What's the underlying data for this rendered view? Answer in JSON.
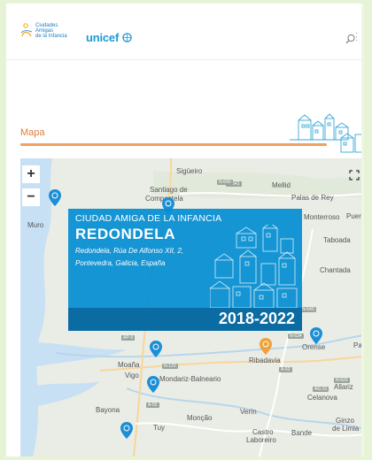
{
  "header": {
    "logo_lines": [
      "Ciudades",
      "Amigas",
      "de la Infancia"
    ],
    "partner_logo": "unicef",
    "icons": {
      "search": "search-icon",
      "menu": "more-vertical-icon"
    }
  },
  "section": {
    "title": "Mapa"
  },
  "map": {
    "zoom_in": "+",
    "zoom_out": "−",
    "places": [
      {
        "name": "Sigüeiro"
      },
      {
        "name": "Santiago de"
      },
      {
        "name": "Compostela"
      },
      {
        "name": "Mellid"
      },
      {
        "name": "Palas de Rey"
      },
      {
        "name": "Muro"
      },
      {
        "name": "Monterroso"
      },
      {
        "name": "Puert"
      },
      {
        "name": "Taboada"
      },
      {
        "name": "Chantada"
      },
      {
        "name": "Pa"
      },
      {
        "name": "Ribadavia"
      },
      {
        "name": "Orense"
      },
      {
        "name": "Moaña"
      },
      {
        "name": "Vigo"
      },
      {
        "name": "Mondariz-Balneario"
      },
      {
        "name": "Allariz"
      },
      {
        "name": "Celanova"
      },
      {
        "name": "Bayona"
      },
      {
        "name": "Verín"
      },
      {
        "name": "Tuy"
      },
      {
        "name": "Monção"
      },
      {
        "name": "Ginzo"
      },
      {
        "name": "de Limia"
      },
      {
        "name": "Castro"
      },
      {
        "name": "Laboreiro"
      },
      {
        "name": "Bande"
      }
    ],
    "roads": [
      "N-541",
      "N-540",
      "AP-9",
      "N-634",
      "A-52",
      "AG-31",
      "N-525",
      "A-55",
      "N-120",
      "N-640"
    ],
    "pin_colors": {
      "default": "#1b8fd6",
      "selected": "#f0a23a"
    }
  },
  "card": {
    "label": "CIUDAD AMIGA DE LA INFANCIA",
    "city": "REDONDELA",
    "address_line1": "Redondela, Rúa De Alfonso XII, 2,",
    "address_line2": "Pontevedra, Galicia, España",
    "years": "2018-2022",
    "color": "#038dd3"
  },
  "colors": {
    "accent": "#e07b39",
    "brand": "#1b7fc1"
  }
}
